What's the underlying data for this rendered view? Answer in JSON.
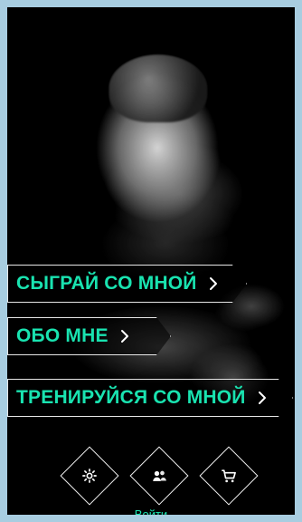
{
  "menu": {
    "play_label": "СЫГРАЙ СО МНОЙ",
    "about_label": "ОБО МНЕ",
    "train_label": "ТРЕНИРУЙСЯ СО МНОЙ"
  },
  "bottom_icons": [
    {
      "name": "settings",
      "icon": "gear-icon"
    },
    {
      "name": "social",
      "icon": "people-icon"
    },
    {
      "name": "store",
      "icon": "cart-icon"
    }
  ],
  "login": {
    "label": "Войти"
  },
  "colors": {
    "accent": "#19e3b0",
    "border": "#ffffff",
    "frame": "#a8cde0",
    "background": "#000000"
  }
}
